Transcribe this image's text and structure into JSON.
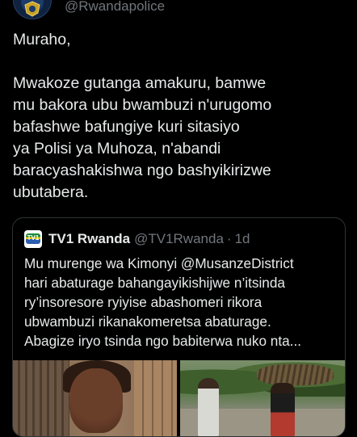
{
  "header": {
    "handle": "@Rwandapolice",
    "avatar_icon": "police-badge-icon"
  },
  "tweet": {
    "text": "Muraho,\n\nMwakoze gutanga amakuru, bamwe\nmu bakora ubu bwambuzi n'urugomo\nbafashwe bafungiye kuri sitasiyo\nya Polisi ya Muhoza, n'abandi\nbaracyashakishwa ngo bashyikirizwe\nubutabera."
  },
  "quote": {
    "logo_icon": "tv1-logo-icon",
    "logo_text": "TV1",
    "name": "TV1 Rwanda",
    "handle": "@TV1Rwanda",
    "separator": "·",
    "time": "1d",
    "text": "Mu murenge wa Kimonyi @MusanzeDistrict\nhari abaturage bahangayikishijwe n’itsinda\nry’insoresore ryiyise abashomeri rikora\nubwambuzi rikanakomeretsa abaturage.\nAbagize iryo tsinda ngo babiterwa  nuko nta...",
    "media": [
      "photo-woman-injured",
      "photo-villagers-road"
    ]
  }
}
